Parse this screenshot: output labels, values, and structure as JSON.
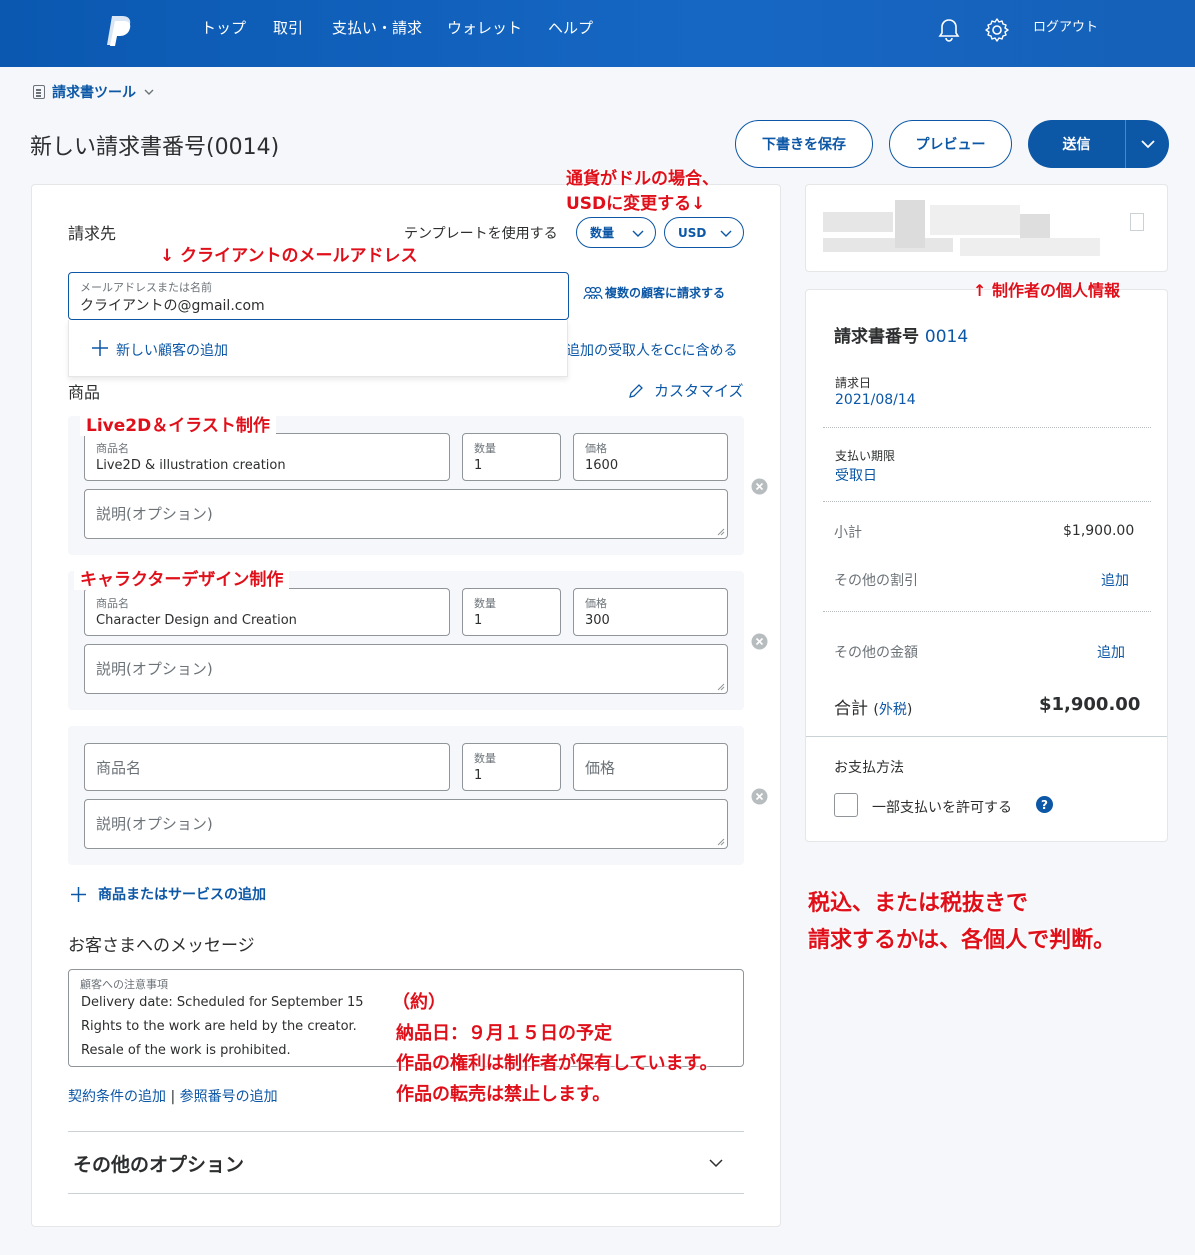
{
  "nav": {
    "logo": "paypal-logo",
    "items": [
      "トップ",
      "取引",
      "支払い・請求",
      "ウォレット",
      "ヘルプ"
    ],
    "logout": "ログアウト"
  },
  "header": {
    "tool": "請求書ツール",
    "title": "新しい請求書番号(0014)",
    "save_draft": "下書きを保存",
    "preview": "プレビュー",
    "send": "送信"
  },
  "billing": {
    "bill_to": "請求先",
    "use_template": "テンプレートを使用する",
    "quantity_pill": "数量",
    "currency_pill": "USD",
    "email_label": "メールアドレスまたは名前",
    "email_value": "クライアントの@gmail.com",
    "multi_customers": "複数の顧客に請求する",
    "add_new_customer": "新しい顧客の追加",
    "add_cc": "追加の受取人をCcに含める"
  },
  "items_section": {
    "heading": "商品",
    "customize": "カスタマイズ",
    "name_label": "商品名",
    "qty_label": "数量",
    "price_label": "価格",
    "desc_placeholder": "説明(オプション)",
    "items": [
      {
        "name": "Live2D & illustration creation",
        "qty": "1",
        "price": "1600"
      },
      {
        "name": "Character Design and Creation",
        "qty": "1",
        "price": "300"
      },
      {
        "name": "",
        "qty": "1",
        "price": ""
      }
    ],
    "add_item": "商品またはサービスの追加"
  },
  "message": {
    "heading": "お客さまへのメッセージ",
    "label": "顧客への注意事項",
    "lines": [
      "Delivery date: Scheduled for September 15",
      "Rights to the work are held by the creator.",
      "Resale of the work is prohibited."
    ],
    "add_terms": "契約条件の追加",
    "separator": "|",
    "add_reference": "参照番号の追加"
  },
  "more_options": "その他のオプション",
  "summary": {
    "invoice_label": "請求書番号",
    "invoice_number": "0014",
    "invoice_date_label": "請求日",
    "invoice_date": "2021/08/14",
    "due_label": "支払い期限",
    "due_value": "受取日",
    "subtotal_label": "小計",
    "subtotal": "$1,900.00",
    "discount_label": "その他の割引",
    "discount_action": "追加",
    "other_amount_label": "その他の金額",
    "other_amount_action": "追加",
    "total_label": "合計",
    "tax_paren_open": "(",
    "tax_link": "外税",
    "tax_paren_close": ")",
    "total": "$1,900.00",
    "payment_method": "お支払方法",
    "partial_payment": "一部支払いを許可する",
    "help": "?"
  },
  "annotations": {
    "currency_note_1": "通貨がドルの場合、",
    "currency_note_2": "USDに変更する↓",
    "client_email": "↓ クライアントのメールアドレス",
    "creator_info": "↑ 制作者の個人情報",
    "item1": "Live2D＆イラスト制作",
    "item2": "キャラクターデザイン制作",
    "tax_note_1": "税込、または税抜きで",
    "tax_note_2": "請求するかは、各個人で判断。",
    "jp_1": "（約）",
    "jp_2": "納品日：９月１５日の予定",
    "jp_3": "作品の権利は制作者が保有しています。",
    "jp_4": "作品の転売は禁止します。"
  },
  "colors": {
    "nav_bg": "#1260ba",
    "accent": "#0c57a6",
    "annotation_red": "#e0101b"
  }
}
